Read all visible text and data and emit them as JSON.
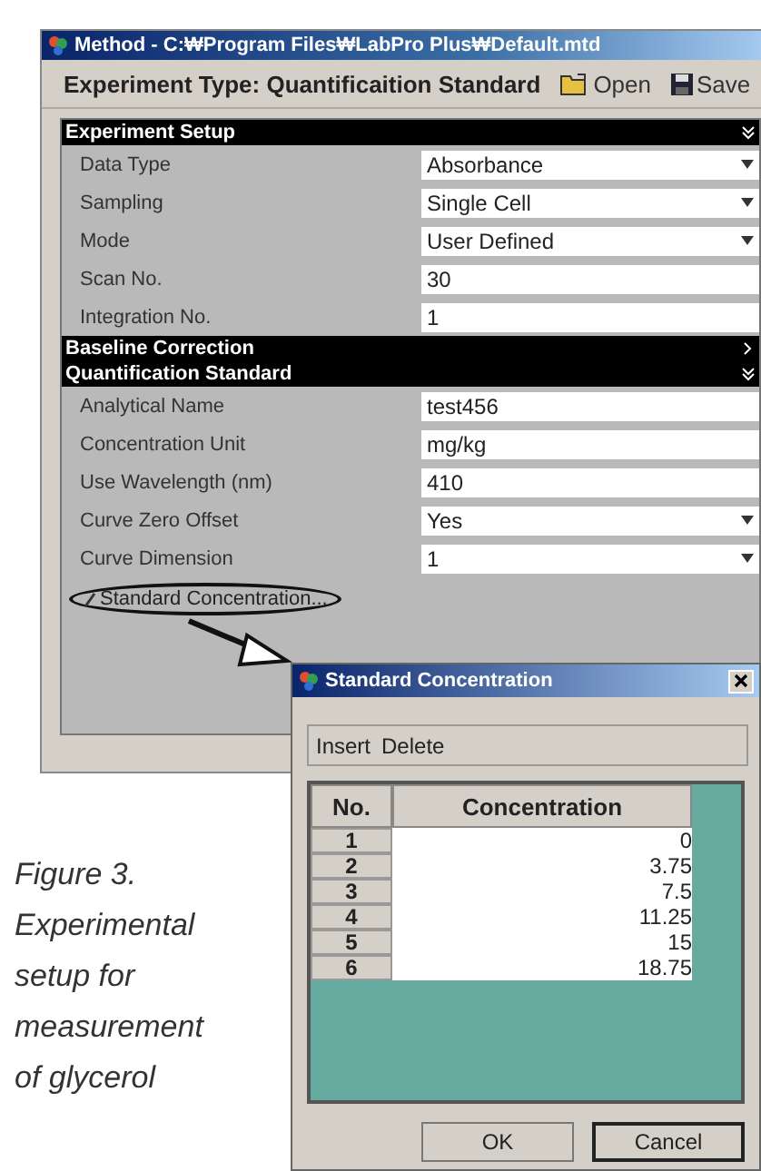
{
  "window": {
    "title": "Method - C:₩Program Files₩LabPro Plus₩Default.mtd"
  },
  "toolbar": {
    "experiment_type": "Experiment Type:  Quantificaition Standard",
    "buttons": [
      {
        "kind": "open",
        "label": "Open"
      },
      {
        "kind": "save",
        "label": "Save"
      }
    ]
  },
  "sections": [
    {
      "title": "Experiment Setup",
      "expanded": true,
      "rows": [
        {
          "label": "Data Type",
          "value": "Absorbance",
          "kind": "dropdown"
        },
        {
          "label": "Sampling",
          "value": "Single Cell",
          "kind": "dropdown"
        },
        {
          "label": "Mode",
          "value": "User Defined",
          "kind": "dropdown"
        },
        {
          "label": "Scan No.",
          "value": "30",
          "kind": "text"
        },
        {
          "label": "Integration No.",
          "value": "1",
          "kind": "text"
        }
      ]
    },
    {
      "title": "Baseline Correction",
      "expanded": false
    },
    {
      "title": "Quantification Standard",
      "expanded": true,
      "rows": [
        {
          "label": "Analytical Name",
          "value": "test456",
          "kind": "text"
        },
        {
          "label": "Concentration Unit",
          "value": "mg/kg",
          "kind": "text"
        },
        {
          "label": "Use Wavelength (nm)",
          "value": "410",
          "kind": "text"
        },
        {
          "label": "Curve Zero Offset",
          "value": "Yes",
          "kind": "dropdown"
        },
        {
          "label": "Curve Dimension",
          "value": "1",
          "kind": "dropdown"
        }
      ]
    }
  ],
  "link": "Standard Concentration...",
  "dialog": {
    "title": "Standard Concentration",
    "toolbar": [
      "Insert",
      "Delete"
    ],
    "columns": [
      "No.",
      "Concentration"
    ],
    "rows": [
      {
        "no": "1",
        "concentration": "0"
      },
      {
        "no": "2",
        "concentration": "3.75"
      },
      {
        "no": "3",
        "concentration": "7.5"
      },
      {
        "no": "4",
        "concentration": "11.25"
      },
      {
        "no": "5",
        "concentration": "15"
      },
      {
        "no": "6",
        "concentration": "18.75"
      }
    ],
    "buttons": [
      {
        "label": "OK",
        "focused": false
      },
      {
        "label": "Cancel",
        "focused": true
      }
    ]
  },
  "caption": "Figure 3. Experimental setup for measurement of glycerol"
}
